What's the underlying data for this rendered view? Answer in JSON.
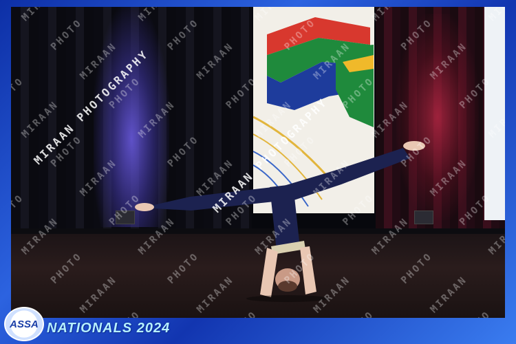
{
  "watermark": {
    "text": "MIRAAN PHOTOGRAPHY"
  },
  "logo": {
    "text": "ASSA"
  },
  "event": {
    "title": "NATIONALS 2024"
  },
  "colors": {
    "frame_blue": "#1a3fb8",
    "flag_red": "#d8382e",
    "flag_green": "#1f8a3c",
    "flag_blue": "#1e3c9c",
    "flag_yellow": "#f0b92a",
    "costume": "#1c2250"
  }
}
